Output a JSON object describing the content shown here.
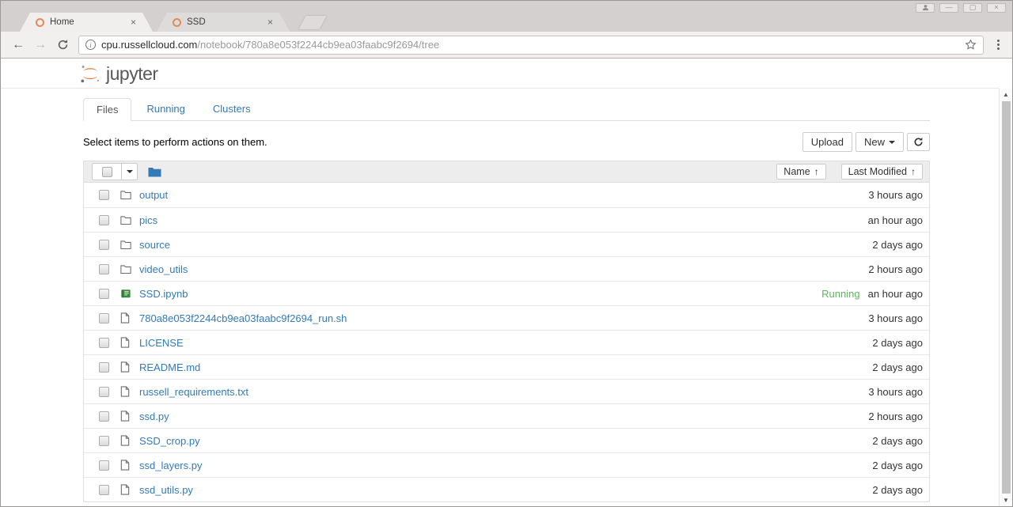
{
  "browser": {
    "tabs": [
      {
        "label": "Home"
      },
      {
        "label": "SSD"
      }
    ],
    "url": {
      "domain": "cpu.russellcloud.com",
      "path": "/notebook/780a8e053f2244cb9ea03faabc9f2694/tree"
    }
  },
  "jupyter": {
    "logo_text": "jupyter",
    "nav_tabs": {
      "files": "Files",
      "running": "Running",
      "clusters": "Clusters"
    },
    "hint": "Select items to perform actions on them.",
    "buttons": {
      "upload": "Upload",
      "new": "New"
    },
    "sort": {
      "name": "Name",
      "modified": "Last Modified",
      "arrow": "↑"
    },
    "files": [
      {
        "name": "output",
        "type": "folder",
        "modified": "3 hours ago"
      },
      {
        "name": "pics",
        "type": "folder",
        "modified": "an hour ago"
      },
      {
        "name": "source",
        "type": "folder",
        "modified": "2 days ago"
      },
      {
        "name": "video_utils",
        "type": "folder",
        "modified": "2 hours ago"
      },
      {
        "name": "SSD.ipynb",
        "type": "notebook",
        "status": "Running",
        "modified": "an hour ago"
      },
      {
        "name": "780a8e053f2244cb9ea03faabc9f2694_run.sh",
        "type": "file",
        "modified": "3 hours ago"
      },
      {
        "name": "LICENSE",
        "type": "file",
        "modified": "2 days ago"
      },
      {
        "name": "README.md",
        "type": "file",
        "modified": "2 days ago"
      },
      {
        "name": "russell_requirements.txt",
        "type": "file",
        "modified": "3 hours ago"
      },
      {
        "name": "ssd.py",
        "type": "file",
        "modified": "2 hours ago"
      },
      {
        "name": "SSD_crop.py",
        "type": "file",
        "modified": "2 days ago"
      },
      {
        "name": "ssd_layers.py",
        "type": "file",
        "modified": "2 days ago"
      },
      {
        "name": "ssd_utils.py",
        "type": "file",
        "modified": "2 days ago"
      }
    ]
  },
  "colors": {
    "link": "#337ab7",
    "running": "#5cb85c",
    "logo_orange": "#f37726"
  }
}
